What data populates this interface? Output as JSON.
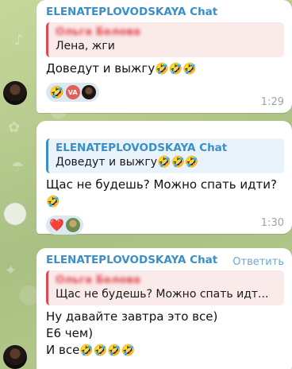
{
  "messages": [
    {
      "sender": "ELENATEPLOVODSKAYA Chat",
      "quote_author": "Ольга Белова",
      "quote_text": "Лена, жги",
      "text": "Доведут и выжгу",
      "emoji": "🤣🤣🤣",
      "reactions": [
        {
          "emoji": "🤣",
          "avatars": [
            "VA",
            ""
          ]
        }
      ],
      "time": "1:29"
    },
    {
      "sender": "",
      "quote_author": "ELENATEPLOVODSKAYA Chat",
      "quote_text": "Доведут и выжгу🤣🤣🤣",
      "text": "Щас не будешь? Можно спать идти?",
      "emoji": "🤣",
      "reactions": [
        {
          "emoji": "❤️",
          "avatars": [
            ""
          ]
        }
      ],
      "time": "1:30"
    },
    {
      "sender": "ELENATEPLOVODSKAYA Chat",
      "reply_label": "Ответить",
      "quote_author": "Ольга Белова",
      "quote_text": "Щас не будешь? Можно спать идт...",
      "line1": "Ну давайте завтра это все)",
      "line2": "Е6  чем)",
      "line3": "И все",
      "emoji": "🤣🤣🤣🤣"
    }
  ]
}
